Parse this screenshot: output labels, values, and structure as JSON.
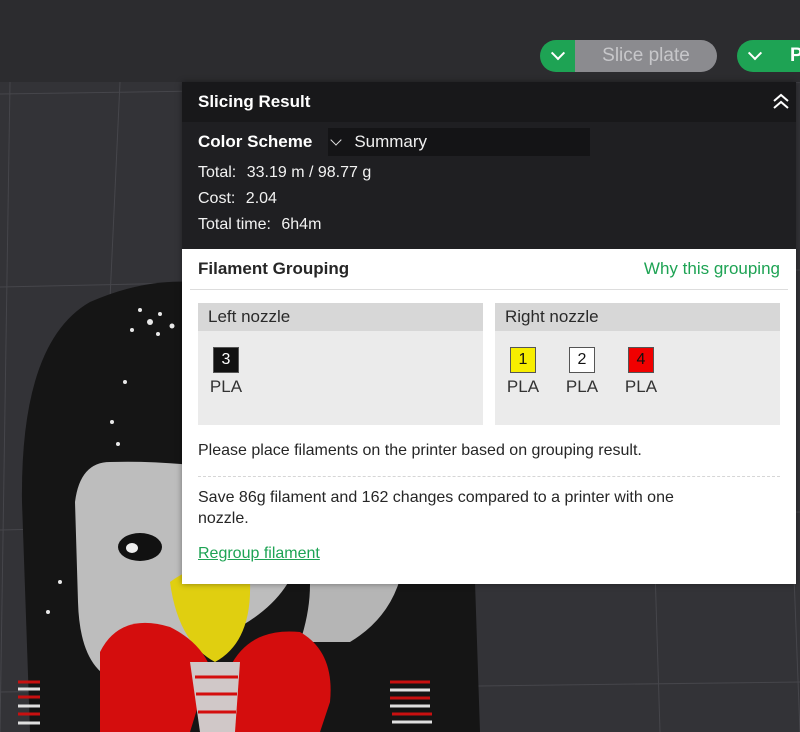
{
  "toolbar": {
    "slice_plate_label": "Slice plate",
    "print_label": "P",
    "accent_color": "#1ea354"
  },
  "slicing_result": {
    "title": "Slicing Result",
    "color_scheme_label": "Color Scheme",
    "color_scheme_value": "Summary",
    "total_label": "Total:",
    "total_value": "33.19 m / 98.77 g",
    "cost_label": "Cost:",
    "cost_value": "2.04",
    "time_label": "Total time:",
    "time_value": "6h4m"
  },
  "filament_grouping": {
    "title": "Filament Grouping",
    "why_link": "Why this grouping",
    "left_nozzle": {
      "label": "Left nozzle",
      "filaments": [
        {
          "id": "3",
          "type": "PLA",
          "color": "#111111",
          "text_color": "#ffffff"
        }
      ]
    },
    "right_nozzle": {
      "label": "Right nozzle",
      "filaments": [
        {
          "id": "1",
          "type": "PLA",
          "color": "#f7ee00",
          "text_color": "#111111"
        },
        {
          "id": "2",
          "type": "PLA",
          "color": "#ffffff",
          "text_color": "#111111"
        },
        {
          "id": "4",
          "type": "PLA",
          "color": "#f00000",
          "text_color": "#111111"
        }
      ]
    },
    "place_note": "Please place filaments on the printer based on grouping result.",
    "save_note_line1": "Save 86g filament and 162 changes compared to a printer with one",
    "save_note_line2": "nozzle.",
    "regroup_link": "Regroup filament"
  }
}
